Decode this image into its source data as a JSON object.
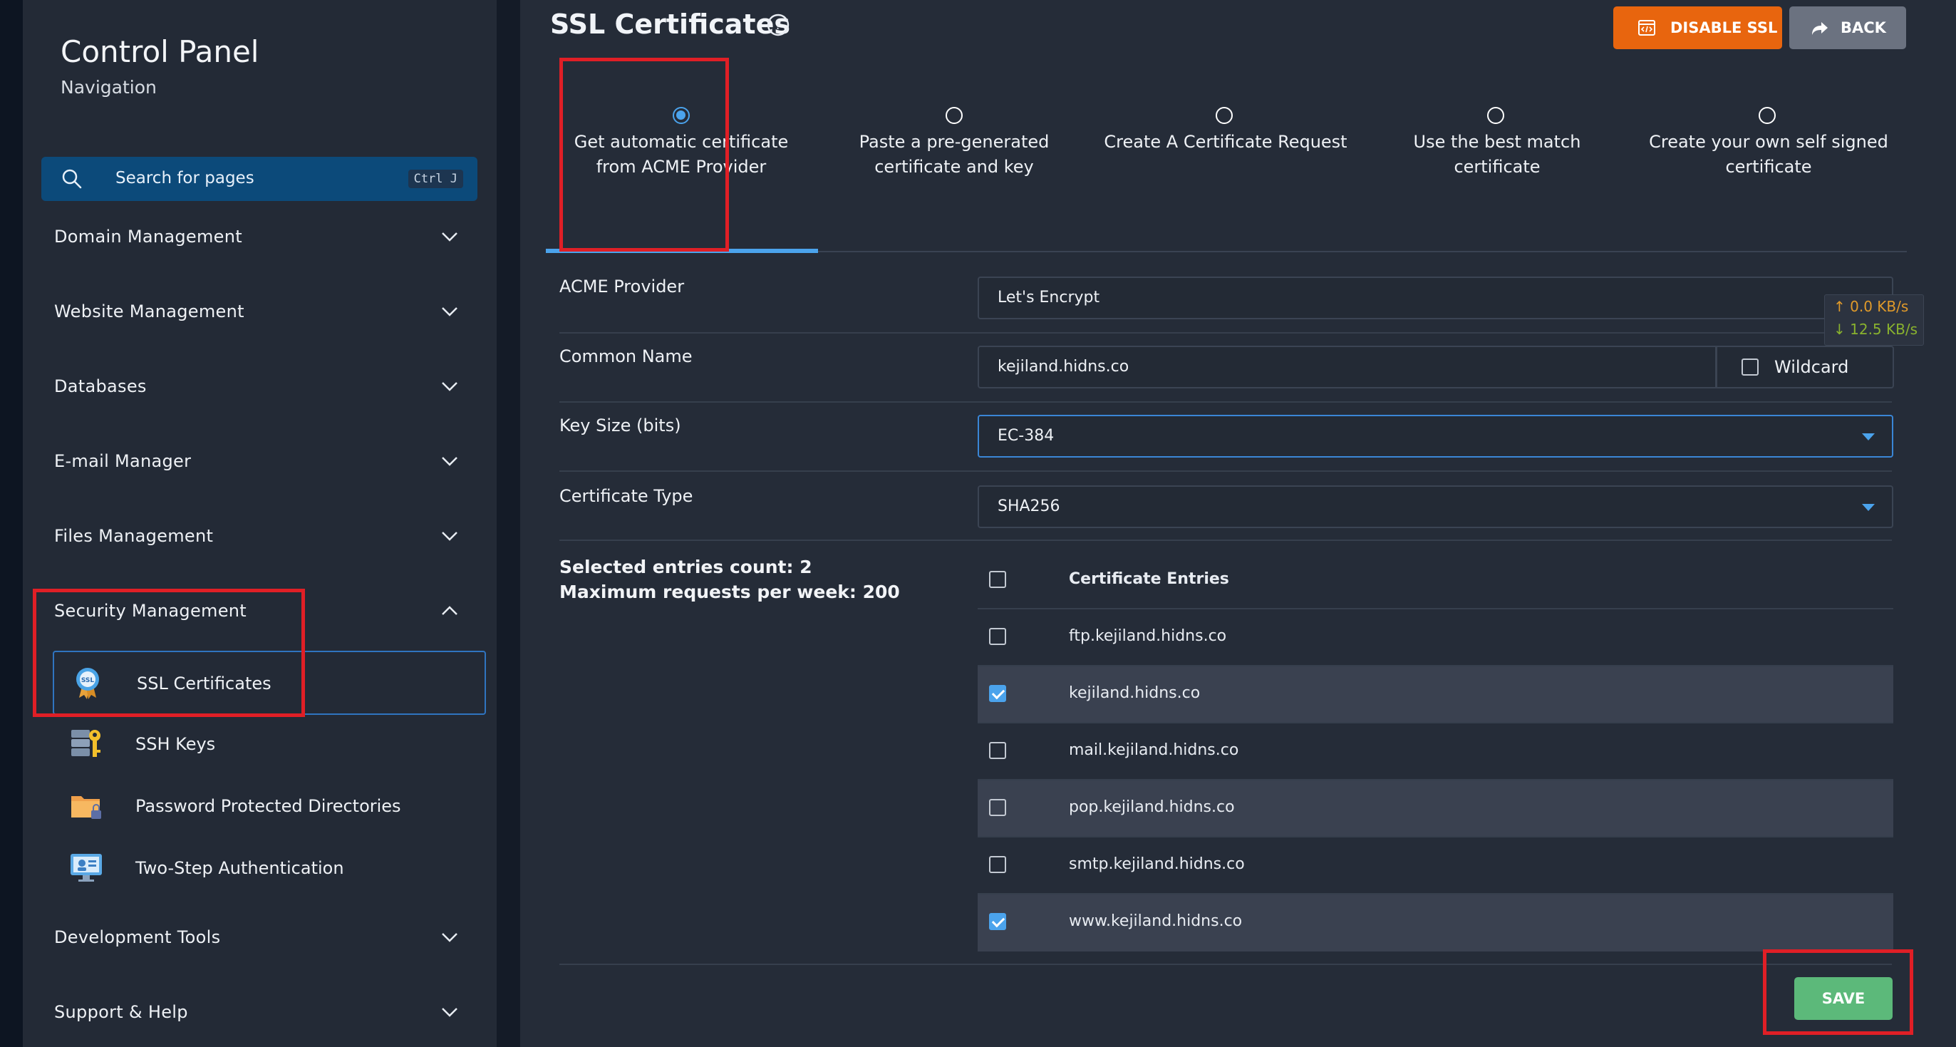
{
  "sidebar": {
    "title": "Control Panel",
    "subtitle": "Navigation",
    "search": {
      "placeholder": "Search for pages",
      "shortcut": "Ctrl J"
    },
    "sections": [
      {
        "label": "Domain Management",
        "expanded": false
      },
      {
        "label": "Website Management",
        "expanded": false
      },
      {
        "label": "Databases",
        "expanded": false
      },
      {
        "label": "E-mail Manager",
        "expanded": false
      },
      {
        "label": "Files Management",
        "expanded": false
      },
      {
        "label": "Security Management",
        "expanded": true
      },
      {
        "label": "Development Tools",
        "expanded": false
      },
      {
        "label": "Support & Help",
        "expanded": false
      }
    ],
    "security_items": [
      {
        "label": "SSL Certificates",
        "icon": "ssl-badge-icon",
        "active": true
      },
      {
        "label": "SSH Keys",
        "icon": "ssh-key-icon",
        "active": false
      },
      {
        "label": "Password Protected Directories",
        "icon": "locked-folder-icon",
        "active": false
      },
      {
        "label": "Two-Step Authentication",
        "icon": "two-step-auth-icon",
        "active": false
      }
    ]
  },
  "header": {
    "title": "SSL Certificates",
    "disable_label": "DISABLE SSL",
    "back_label": "BACK"
  },
  "tabs": [
    {
      "label": "Get automatic certificate from ACME Provider",
      "selected": true
    },
    {
      "label": "Paste a pre-generated certificate and key",
      "selected": false
    },
    {
      "label": "Create A Certificate Request",
      "selected": false
    },
    {
      "label": "Use the best match certificate",
      "selected": false
    },
    {
      "label": "Create your own self signed certificate",
      "selected": false
    }
  ],
  "form": {
    "acme_provider": {
      "label": "ACME Provider",
      "value": "Let's Encrypt"
    },
    "common_name": {
      "label": "Common Name",
      "value": "kejiland.hidns.co",
      "wildcard_label": "Wildcard",
      "wildcard_checked": false
    },
    "key_size": {
      "label": "Key Size (bits)",
      "value": "EC-384"
    },
    "certificate_type": {
      "label": "Certificate Type",
      "value": "SHA256"
    },
    "selected_count": "Selected entries count: 2",
    "max_requests": "Maximum requests per week: 200",
    "entries_header": "Certificate Entries",
    "entries": [
      {
        "name": "ftp.kejiland.hidns.co",
        "checked": false
      },
      {
        "name": "kejiland.hidns.co",
        "checked": true
      },
      {
        "name": "mail.kejiland.hidns.co",
        "checked": false
      },
      {
        "name": "pop.kejiland.hidns.co",
        "checked": false
      },
      {
        "name": "smtp.kejiland.hidns.co",
        "checked": false
      },
      {
        "name": "www.kejiland.hidns.co",
        "checked": true
      }
    ],
    "save_label": "SAVE"
  },
  "network_speed": {
    "up": "↑ 0.0 KB/s",
    "down": "↓ 12.5 KB/s"
  },
  "colors": {
    "accent": "#4ba3ec",
    "disable_button": "#e8650e",
    "back_button": "#6b7280",
    "save_button": "#5cb97a",
    "highlight_box": "#e01f26"
  }
}
